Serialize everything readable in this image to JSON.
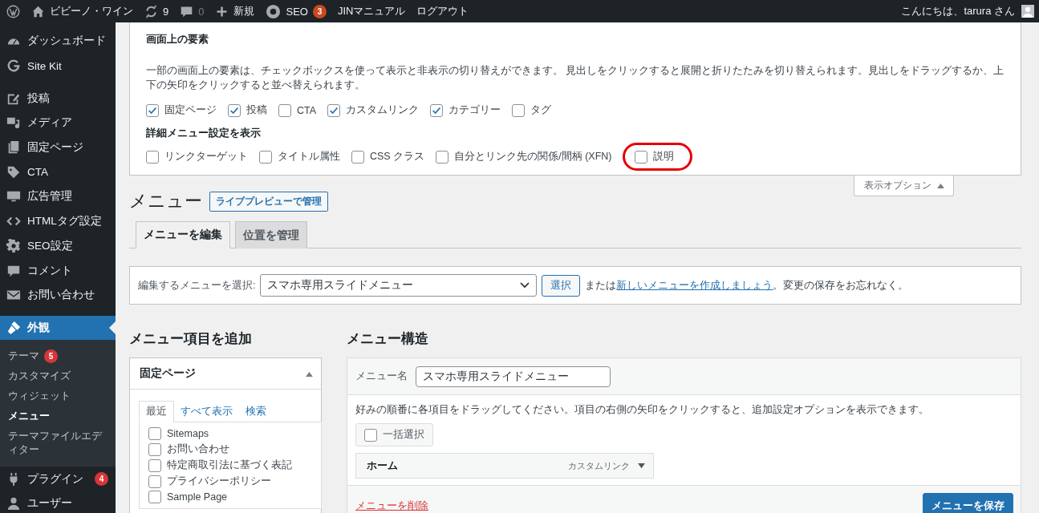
{
  "admin_bar": {
    "site_name": "ビビーノ・ワイン",
    "updates": "9",
    "comments": "0",
    "new": "新規",
    "seo": "SEO",
    "seo_badge": "3",
    "links": [
      "JINマニュアル",
      "ログアウト"
    ],
    "greeting": "こんにちは、tarura さん"
  },
  "sidebar": {
    "groups": [
      {
        "items": [
          {
            "label": "ダッシュボード",
            "selected": false
          },
          {
            "label": "Site Kit",
            "selected": false
          }
        ]
      },
      {
        "items": [
          {
            "label": "投稿",
            "selected": false
          },
          {
            "label": "メディア",
            "selected": false
          },
          {
            "label": "固定ページ",
            "selected": false
          },
          {
            "label": "CTA",
            "selected": false
          },
          {
            "label": "広告管理",
            "selected": false
          },
          {
            "label": "HTMLタグ設定",
            "selected": false
          },
          {
            "label": "SEO設定",
            "selected": false
          },
          {
            "label": "コメント",
            "selected": false
          },
          {
            "label": "お問い合わせ",
            "selected": false
          }
        ]
      },
      {
        "items": [
          {
            "label": "外観",
            "selected": true,
            "submenu": [
              {
                "label": "テーマ",
                "badge": "5",
                "selected": false
              },
              {
                "label": "カスタマイズ",
                "selected": false
              },
              {
                "label": "ウィジェット",
                "selected": false
              },
              {
                "label": "メニュー",
                "selected": true
              },
              {
                "label": "テーマファイルエディター",
                "selected": false
              }
            ]
          },
          {
            "label": "プラグイン",
            "badge": "4",
            "selected": false
          },
          {
            "label": "ユーザー",
            "selected": false
          }
        ]
      }
    ]
  },
  "screen_options": {
    "heading": "画面上の要素",
    "description": "一部の画面上の要素は、チェックボックスを使って表示と非表示の切り替えができます。 見出しをクリックすると展開と折りたたみを切り替えられます。見出しをドラッグするか、上下の矢印をクリックすると並べ替えられます。",
    "boxes": [
      {
        "label": "固定ページ",
        "checked": true
      },
      {
        "label": "投稿",
        "checked": true
      },
      {
        "label": "CTA",
        "checked": false
      },
      {
        "label": "カスタムリンク",
        "checked": true
      },
      {
        "label": "カテゴリー",
        "checked": true
      },
      {
        "label": "タグ",
        "checked": false
      }
    ],
    "advanced_heading": "詳細メニュー設定を表示",
    "advanced": [
      {
        "label": "リンクターゲット",
        "checked": false,
        "circled": false
      },
      {
        "label": "タイトル属性",
        "checked": false,
        "circled": false
      },
      {
        "label": "CSS クラス",
        "checked": false,
        "circled": false
      },
      {
        "label": "自分とリンク先の関係/間柄 (XFN)",
        "checked": false,
        "circled": false
      },
      {
        "label": "説明",
        "checked": false,
        "circled": true
      }
    ],
    "toggle": "表示オプション"
  },
  "page": {
    "title": "メニュー",
    "live_preview_button": "ライブプレビューで管理",
    "tabs": [
      {
        "label": "メニューを編集",
        "selected": true
      },
      {
        "label": "位置を管理",
        "selected": false
      }
    ]
  },
  "select_bar": {
    "label": "編集するメニューを選択:",
    "value": "スマホ専用スライドメニュー",
    "button": "選択",
    "text_before": "または",
    "link": "新しいメニューを作成しましょう",
    "text_after": "。変更の保存をお忘れなく。"
  },
  "add_items": {
    "heading": "メニュー項目を追加",
    "panel_title": "固定ページ",
    "tabs": [
      {
        "label": "最近",
        "selected": true
      },
      {
        "label": "すべて表示",
        "selected": false
      },
      {
        "label": "検索",
        "selected": false
      }
    ],
    "pages": [
      {
        "label": "Sitemaps",
        "checked": false
      },
      {
        "label": "お問い合わせ",
        "checked": false
      },
      {
        "label": "特定商取引法に基づく表記",
        "checked": false
      },
      {
        "label": "プライバシーポリシー",
        "checked": false
      },
      {
        "label": "Sample Page",
        "checked": false
      }
    ]
  },
  "structure": {
    "heading": "メニュー構造",
    "name_label": "メニュー名",
    "name_value": "スマホ専用スライドメニュー",
    "instructions": "好みの順番に各項目をドラッグしてください。項目の右側の矢印をクリックすると、追加設定オプションを表示できます。",
    "bulk_select": "一括選択",
    "bulk_checked": false,
    "items": [
      {
        "title": "ホーム",
        "type": "カスタムリンク"
      }
    ],
    "delete_link": "メニューを削除",
    "save_button": "メニューを保存"
  }
}
